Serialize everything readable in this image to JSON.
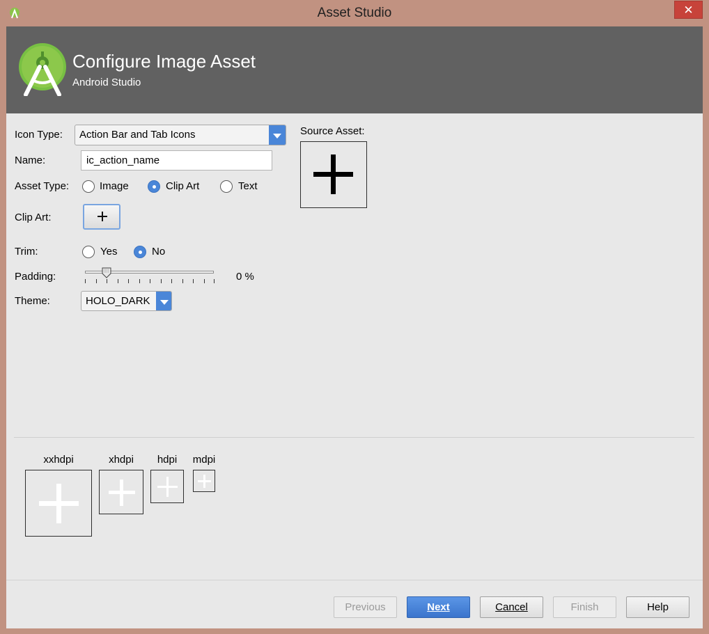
{
  "window": {
    "title": "Asset Studio",
    "close_glyph": "✕"
  },
  "header": {
    "title": "Configure Image Asset",
    "subtitle": "Android Studio",
    "icon": "android-studio-logo"
  },
  "form": {
    "icon_type": {
      "label": "Icon Type:",
      "value": "Action Bar and Tab Icons"
    },
    "name": {
      "label": "Name:",
      "value": "ic_action_name"
    },
    "asset_type": {
      "label": "Asset Type:",
      "options": [
        "Image",
        "Clip Art",
        "Text"
      ],
      "selected": "Clip Art"
    },
    "clip_art": {
      "label": "Clip Art:",
      "icon": "plus-icon"
    },
    "trim": {
      "label": "Trim:",
      "options": [
        "Yes",
        "No"
      ],
      "selected": "No"
    },
    "padding": {
      "label": "Padding:",
      "value_text": "0 %",
      "value": 0
    },
    "theme": {
      "label": "Theme:",
      "value": "HOLO_DARK"
    }
  },
  "source_asset": {
    "label": "Source Asset:",
    "icon": "plus-icon"
  },
  "previews": [
    {
      "label": "xxhdpi"
    },
    {
      "label": "xhdpi"
    },
    {
      "label": "hdpi"
    },
    {
      "label": "mdpi"
    }
  ],
  "buttons": {
    "previous": "Previous",
    "next": "Next",
    "cancel": "Cancel",
    "finish": "Finish",
    "help": "Help"
  },
  "colors": {
    "accent": "#4a86d8",
    "header_bg": "#616161",
    "frame": "#c19281",
    "close": "#c7433a"
  }
}
